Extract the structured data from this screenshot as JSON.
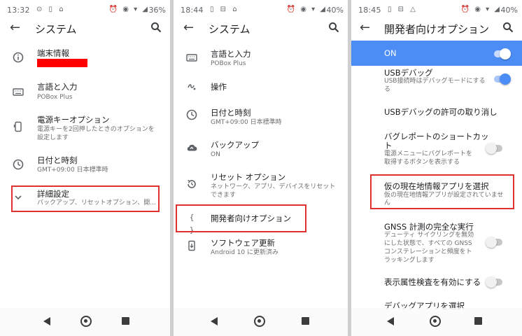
{
  "colors": {
    "accent_blue": "#4c8df5",
    "highlight_red": "#e03131",
    "redaction_red": "#ff0000"
  },
  "panel1": {
    "status": {
      "time": "13:32",
      "battery": "36%"
    },
    "title": "システム",
    "items": [
      {
        "icon": "info-icon",
        "title": "端末情報"
      },
      {
        "icon": "keyboard-icon",
        "title": "言語と入力",
        "subtitle": "POBox Plus"
      },
      {
        "icon": "power-key-icon",
        "title": "電源キーオプション",
        "subtitle": [
          "電源キーを2回押したときのオプションを",
          "設定します"
        ]
      },
      {
        "icon": "clock-icon",
        "title": "日付と時刻",
        "subtitle": "GMT+09:00 日本標準時"
      },
      {
        "icon": "chevron-down-icon",
        "title": "詳細設定",
        "subtitle": "バックアップ、リセットオプション、開..."
      }
    ]
  },
  "panel2": {
    "status": {
      "time": "18:44",
      "battery": "40%"
    },
    "title": "システム",
    "items": [
      {
        "icon": "keyboard-icon",
        "title": "言語と入力",
        "subtitle": "POBox Plus"
      },
      {
        "icon": "gesture-icon",
        "title": "操作"
      },
      {
        "icon": "clock-icon",
        "title": "日付と時刻",
        "subtitle": "GMT+09:00 日本標準時"
      },
      {
        "icon": "cloud-backup-icon",
        "title": "バックアップ",
        "subtitle": "ON"
      },
      {
        "icon": "reset-icon",
        "title": "リセット オプション",
        "subtitle": [
          "ネットワーク、アプリ、デバイスをリセット",
          "できます"
        ]
      },
      {
        "icon": "code-braces-icon",
        "title": "開発者向けオプション"
      },
      {
        "icon": "system-update-icon",
        "title": "ソフトウェア更新",
        "subtitle": "Android 10 に更新済み"
      }
    ]
  },
  "panel3": {
    "status": {
      "time": "18:45",
      "battery": "40%"
    },
    "title": "開発者向けオプション",
    "master": {
      "label": "ON",
      "state": "on"
    },
    "items": [
      {
        "title": "USBデバッグ",
        "subtitle": [
          "USB接続時はデバッグモードにする",
          "る"
        ],
        "toggle": "on"
      },
      {
        "title": "USBデバッグの許可の取り消し"
      },
      {
        "title": [
          "バグレポートのショートカッ",
          "ト"
        ],
        "subtitle": [
          "電源メニューにバグレポートを",
          "取得するボタンを表示する"
        ],
        "toggle": "off"
      },
      {
        "title": "仮の現在地情報アプリを選択",
        "subtitle": [
          "仮の現在地情報アプリが設定されていませ",
          "ん"
        ]
      },
      {
        "title": "GNSS 計測の完全な実行",
        "subtitle": [
          "デューティ サイクリングを無効",
          "にした状態で、すべての GNSS",
          "コンステレーションと頻度をト",
          "ラッキングします"
        ],
        "toggle": "off"
      },
      {
        "title": "表示属性検査を有効にする",
        "toggle": "off"
      },
      {
        "title": "デバッグアプリを選択"
      }
    ]
  }
}
